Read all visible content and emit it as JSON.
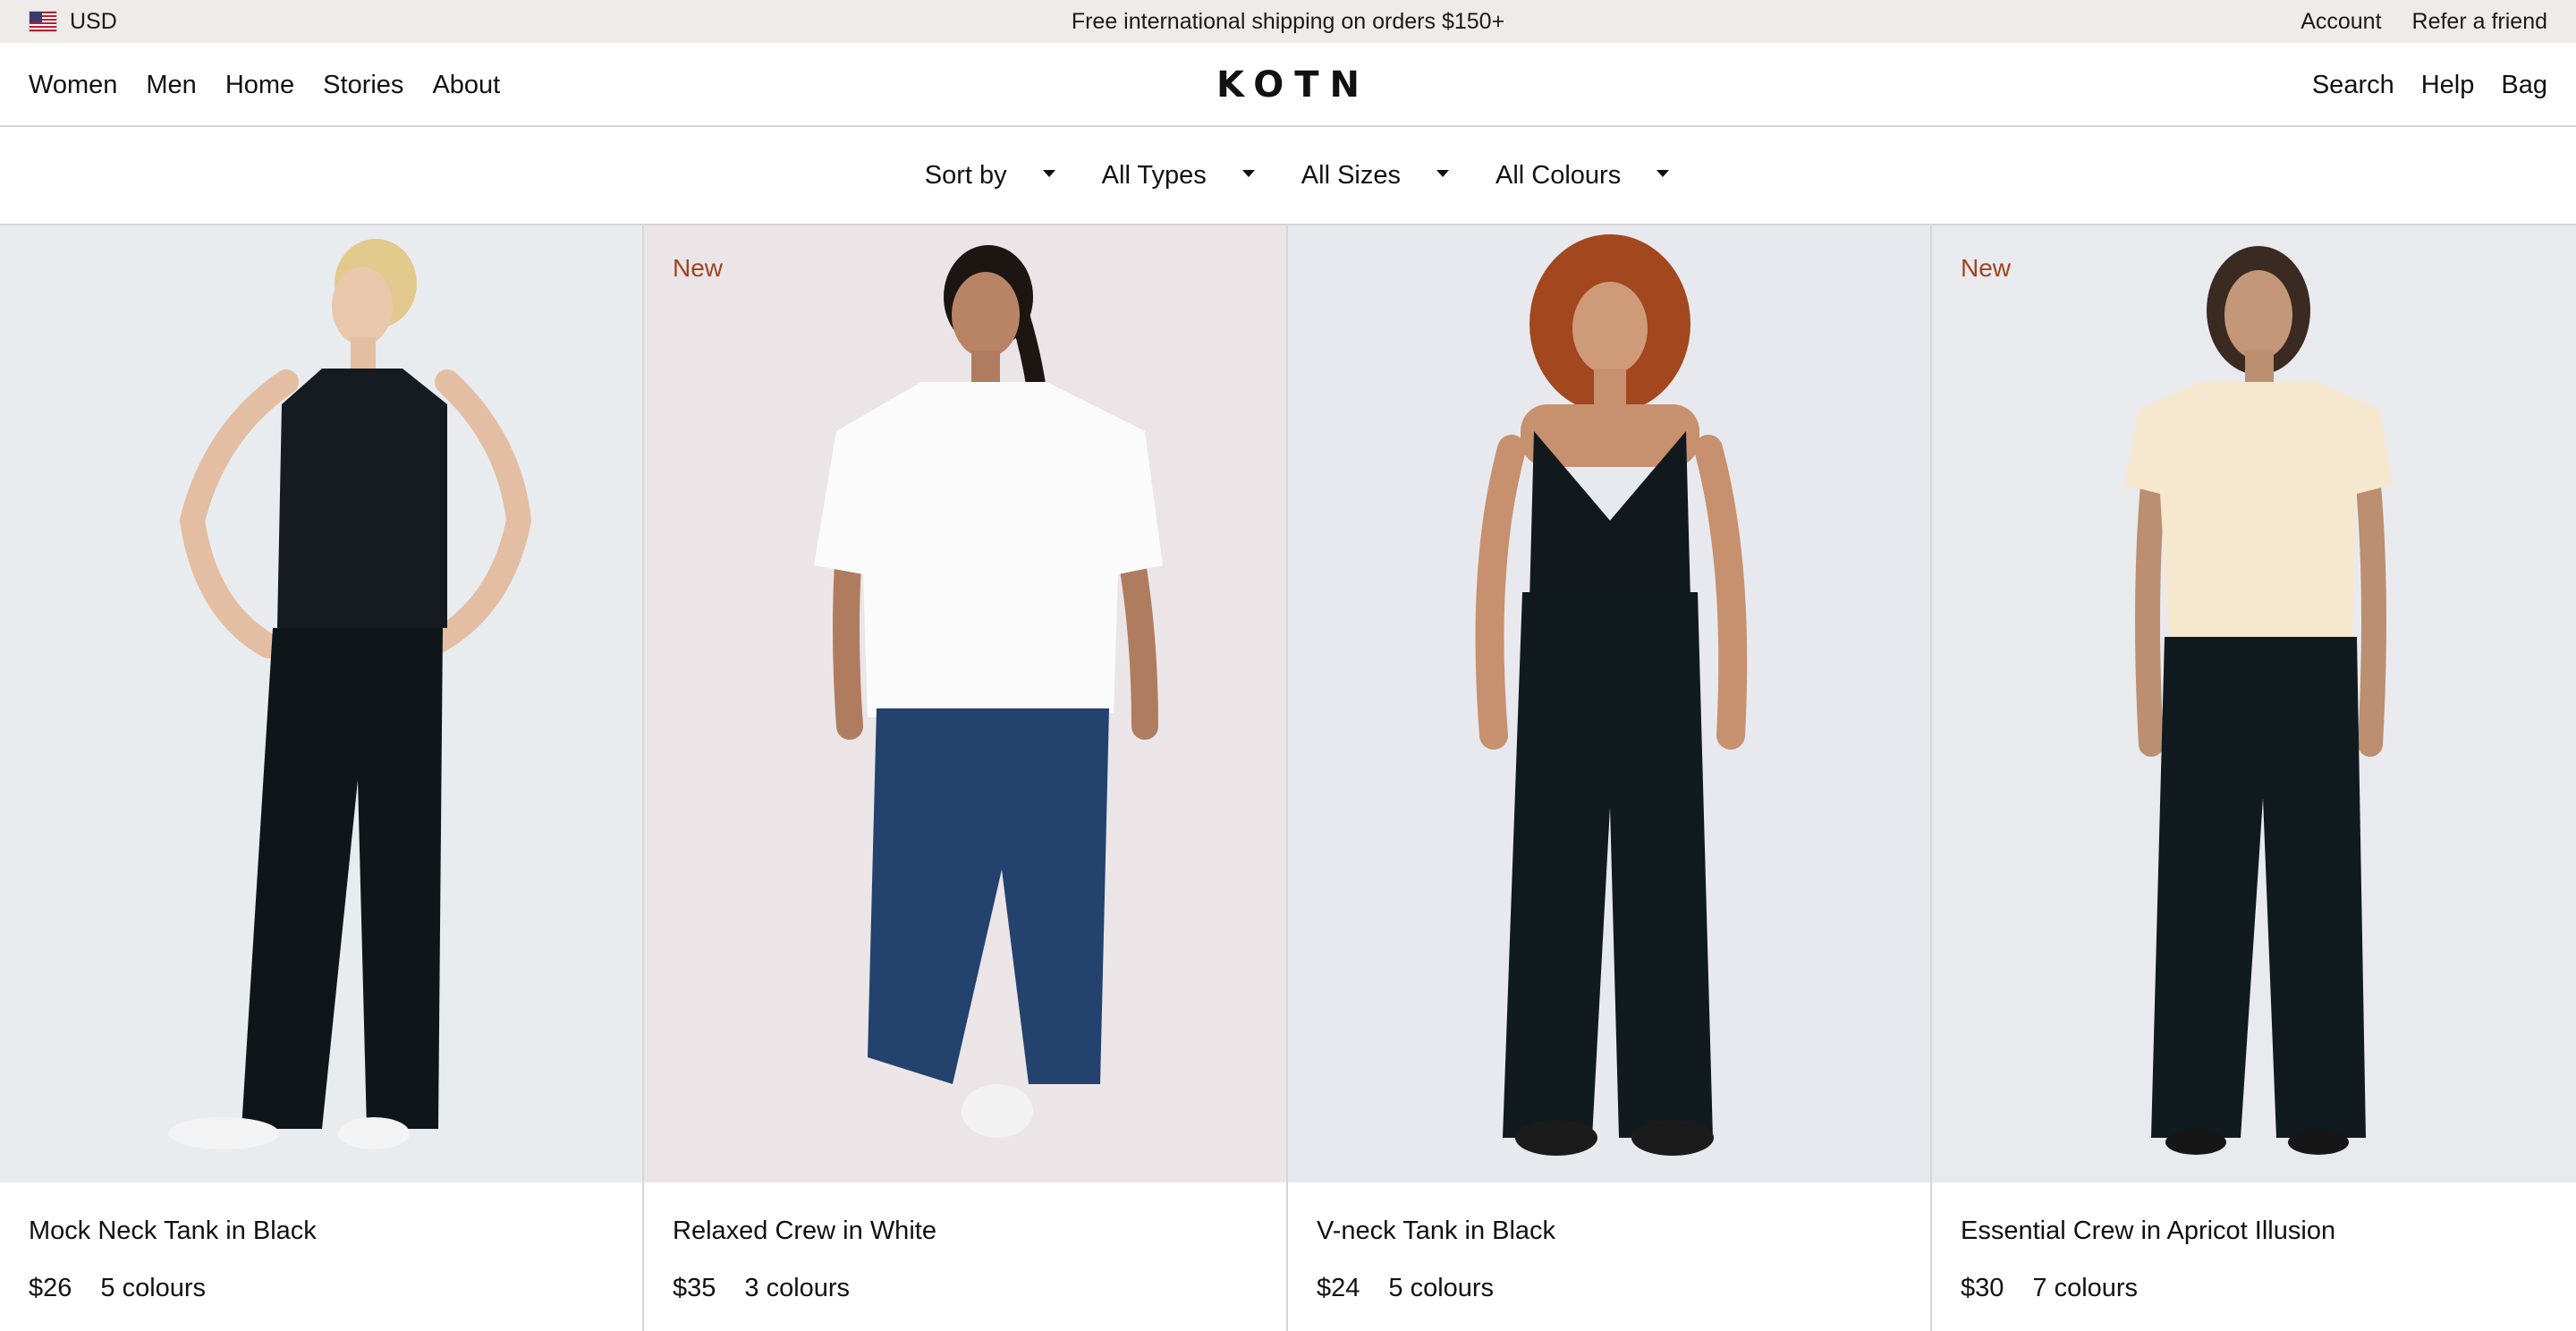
{
  "topbar": {
    "currency": "USD",
    "flag_icon": "us-flag-icon",
    "shipping": "Free international shipping on orders $150+",
    "account": "Account",
    "refer": "Refer a friend"
  },
  "header": {
    "logo": "KOTN",
    "nav": [
      "Women",
      "Men",
      "Home",
      "Stories",
      "About"
    ],
    "right": [
      "Search",
      "Help",
      "Bag"
    ]
  },
  "filters": [
    "Sort by",
    "All Types",
    "All Sizes",
    "All Colours"
  ],
  "colors": {
    "badge": "#a0431f",
    "topbar_bg": "#efebea"
  },
  "products": [
    {
      "name": "Mock Neck Tank in Black",
      "price": "$26",
      "colours": "5 colours",
      "badge": ""
    },
    {
      "name": "Relaxed Crew in White",
      "price": "$35",
      "colours": "3 colours",
      "badge": "New"
    },
    {
      "name": "V-neck Tank in Black",
      "price": "$24",
      "colours": "5 colours",
      "badge": ""
    },
    {
      "name": "Essential Crew in Apricot Illusion",
      "price": "$30",
      "colours": "7 colours",
      "badge": "New"
    }
  ]
}
